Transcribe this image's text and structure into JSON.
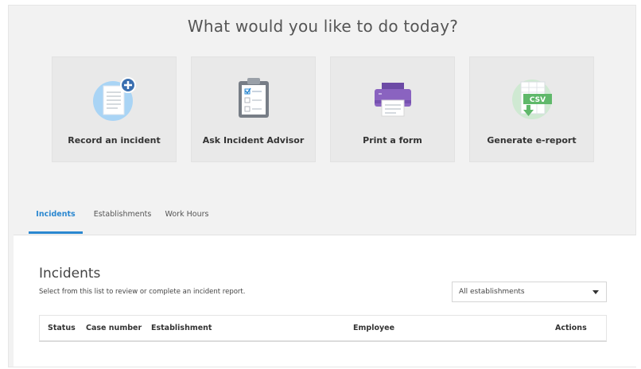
{
  "headline": "What would you like to do today?",
  "cards": [
    {
      "label": "Record an incident",
      "icon": "record-incident-icon"
    },
    {
      "label": "Ask Incident Advisor",
      "icon": "clipboard-checklist-icon"
    },
    {
      "label": "Print a form",
      "icon": "printer-icon"
    },
    {
      "label": "Generate e-report",
      "icon": "csv-report-icon"
    }
  ],
  "tabs": [
    {
      "label": "Incidents",
      "active": true
    },
    {
      "label": "Establishments",
      "active": false
    },
    {
      "label": "Work Hours",
      "active": false
    }
  ],
  "panel": {
    "title": "Incidents",
    "subtitle": "Select from this list to review or complete an incident report.",
    "filter": {
      "selected": "All establishments"
    }
  },
  "table": {
    "columns": [
      "Status",
      "Case number",
      "Establishment",
      "Employee",
      "Actions"
    ]
  },
  "colors": {
    "accent": "#2a87d0",
    "record_icon_bg": "#a9d4f5",
    "record_badge": "#3b6fb0",
    "printer": "#8a63c0",
    "csv_green": "#5fb86a",
    "csv_bg": "#cfe9d2"
  }
}
